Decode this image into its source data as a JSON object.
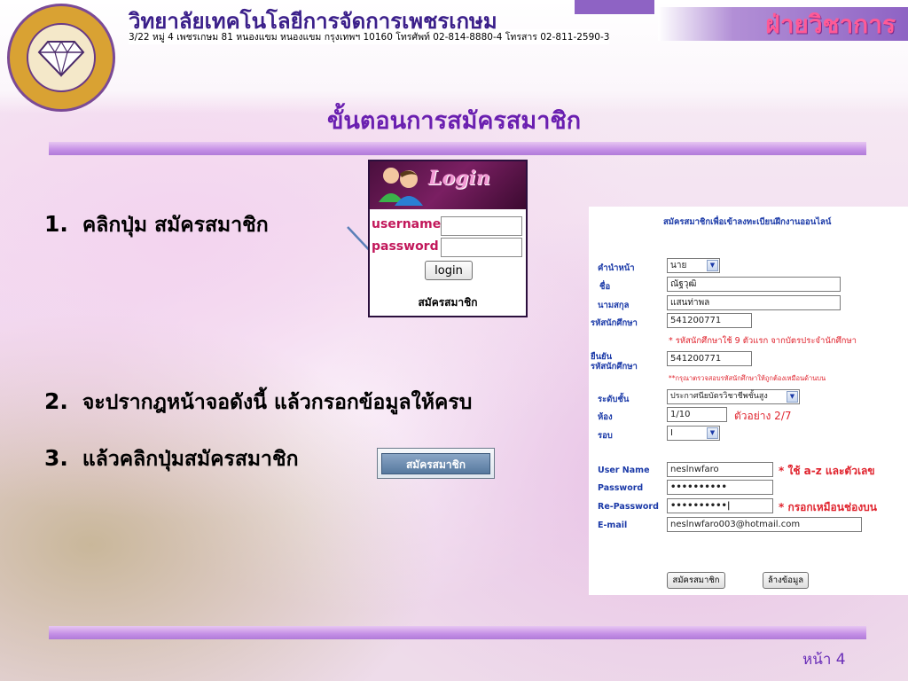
{
  "header": {
    "school_name": "วิทยาลัยเทคโนโลยีการจัดการเพชรเกษม",
    "address": "3/22 หมู่ 4 เพชรเกษม 81 หนองแขม หนองแขม กรุงเทพฯ 10160 โทรศัพท์ 02-814-8880-4 โทรสาร 02-811-2590-3",
    "department": "ฝ่ายวิชาการ",
    "logo_icon": "college-seal-icon"
  },
  "page_title": "ขั้นตอนการสมัครสมาชิก",
  "steps": [
    {
      "num": "1.",
      "text": "คลิกปุ่ม สมัครสมาชิก"
    },
    {
      "num": "2.",
      "text": "จะปรากฎหน้าจอดังนี้ แล้วกรอกข้อมูลให้ครบ"
    },
    {
      "num": "3.",
      "text": "แล้วคลิกปุ่มสมัครสมาชิก"
    }
  ],
  "step3_button_label": "สมัครสมาชิก",
  "login_box": {
    "title": "Login",
    "username_label": "username",
    "password_label": "password",
    "login_button": "login",
    "register_link": "สมัครสมาชิก"
  },
  "registration_form": {
    "title": "สมัครสมาชิกเพื่อเข้าลงทะเบียนฝึกงานออนไลน์",
    "prefix_label": "คำนำหน้า",
    "prefix_value": "นาย",
    "first_name_label": "ชื่อ",
    "first_name_value": "ณัฐวุฒิ",
    "last_name_label": "นามสกุล",
    "last_name_value": "แสนท่าพล",
    "student_id_label": "รหัสนักศึกษา",
    "student_id_value": "541200771",
    "student_id_hint": "* รหัสนักศึกษาใช้ 9 ตัวแรก จากบัตรประจำนักศึกษา",
    "confirm_label_1": "ยืนยัน",
    "confirm_label_2": "รหัสนักศึกษา",
    "confirm_value": "541200771",
    "confirm_hint": "**กรุณาตรวจสอบรหัสนักศึกษาให้ถูกต้องเหมือนด้านบน",
    "level_label": "ระดับชั้น",
    "level_value": "ประกาศนียบัตรวิชาชีพชั้นสูง",
    "room_label": "ห้อง",
    "room_value": "1/10",
    "room_hint": "ตัวอย่าง 2/7",
    "round_label": "รอบ",
    "round_value": "I",
    "username_label": "User Name",
    "username_value": "neslnwfaro",
    "username_hint": "* ใช้ a-z และตัวเลข",
    "password_label": "Password",
    "password_value": "••••••••••",
    "repassword_label": "Re-Password",
    "repassword_value": "••••••••••|",
    "repassword_hint": "* กรอกเหมือนช่องบน",
    "email_label": "E-mail",
    "email_value": "neslnwfaro003@hotmail.com",
    "submit_button": "สมัครสมาชิก",
    "clear_button": "ล้างข้อมูล"
  },
  "page_number": "หน้า 4",
  "colors": {
    "title": "#6a1fb0",
    "label_blue": "#1b3aa8",
    "hint_red": "#e0242e",
    "department_pink": "#ff5a96"
  }
}
